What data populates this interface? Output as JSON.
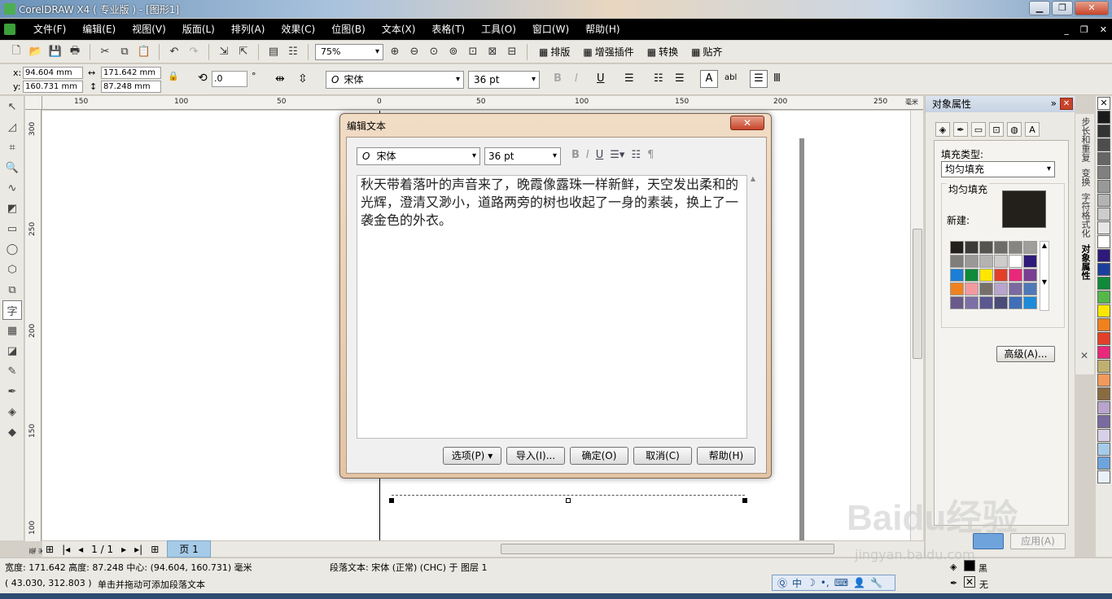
{
  "window": {
    "title": "CorelDRAW X4 ( 专业版 ) - [图形1]"
  },
  "menu": [
    "文件(F)",
    "编辑(E)",
    "视图(V)",
    "版面(L)",
    "排列(A)",
    "效果(C)",
    "位图(B)",
    "文本(X)",
    "表格(T)",
    "工具(O)",
    "窗口(W)",
    "帮助(H)"
  ],
  "toolbar": {
    "zoom": "75%",
    "buttons": [
      "排版",
      "增强插件",
      "转换",
      "贴齐"
    ]
  },
  "propertybar": {
    "x_label": "x:",
    "x": "94.604 mm",
    "y_label": "y:",
    "y": "160.731 mm",
    "w": "171.642 mm",
    "h": "87.248 mm",
    "angle": ".0",
    "angle_unit": "°",
    "font": "宋体",
    "size": "36 pt"
  },
  "rulers": {
    "h": [
      "150",
      "100",
      "50",
      "0",
      "50",
      "100",
      "150",
      "200",
      "250"
    ],
    "h_unit": "毫米",
    "v": [
      "300",
      "250",
      "200",
      "150",
      "100"
    ],
    "v_unit": "毫米"
  },
  "dialog": {
    "title": "编辑文本",
    "font": "宋体",
    "size": "36 pt",
    "text": "秋天带着落叶的声音来了，晚霞像露珠一样新鲜，天空发出柔和的光辉，澄清又渺小，道路两旁的树也收起了一身的素装，换上了一袭金色的外衣。",
    "buttons": {
      "options": "选项(P)",
      "import": "导入(I)...",
      "ok": "确定(O)",
      "cancel": "取消(C)",
      "help": "帮助(H)"
    }
  },
  "pagenav": {
    "page": "1 / 1",
    "tab": "页 1"
  },
  "docker": {
    "title": "对象属性",
    "fill_type_label": "填充类型:",
    "fill_type": "均匀填充",
    "group_title": "均匀填充",
    "new_label": "新建:",
    "advanced": "高级(A)...",
    "apply": "应用(A)",
    "new_color": "#231f1b",
    "palette": [
      "#231f1b",
      "#3c3a38",
      "#555350",
      "#6e6c69",
      "#878581",
      "#a09e9b",
      "#807e7c",
      "#9a9896",
      "#b5b3b1",
      "#cfcdcb",
      "#ffffff",
      "#2e1a78",
      "#1b7fd6",
      "#0e8a3a",
      "#ffe600",
      "#e3402a",
      "#e8287a",
      "#7a3e92",
      "#f0821e",
      "#f29aa0",
      "#76706a",
      "#b8a4cc",
      "#7b6aa0",
      "#4f78b8",
      "#6a5a8c",
      "#7c6fa6",
      "#5b5790",
      "#4b4c78",
      "#3f6fb8",
      "#1f8ad8"
    ]
  },
  "side_tabs": [
    "步长和重复",
    "变换",
    "字符格式化",
    "对象属性"
  ],
  "palette_bar": [
    "#ffffff",
    "#1a1a1a",
    "#333333",
    "#4d4d4d",
    "#666666",
    "#808080",
    "#999999",
    "#b3b3b3",
    "#cccccc",
    "#e6e6e6",
    "#ffffff",
    "#2e1a78",
    "#1b3f9a",
    "#0e8a3a",
    "#54b848",
    "#ffe600",
    "#f0821e",
    "#e3402a",
    "#e8287a",
    "#c0b070",
    "#f29a5a",
    "#8a6a40",
    "#b8a4cc",
    "#7b6aa0",
    "#d8d0e8",
    "#a6cbe8",
    "#6fa3dc",
    "#e8f0f8"
  ],
  "status": {
    "line1_left": "宽度: 171.642  高度: 87.248  中心: (94.604, 160.731)  毫米",
    "line1_mid": "段落文本: 宋体 (正常) (CHC) 于 图层 1",
    "line2_left": "( 43.030, 312.803 )",
    "line2_mid": "单击并拖动可添加段落文本",
    "fill_none": "无",
    "outline_black": "黑"
  },
  "ime": {
    "mode": "中"
  },
  "watermark": {
    "logo": "Baidu经验",
    "url": "jingyan.baidu.com"
  }
}
